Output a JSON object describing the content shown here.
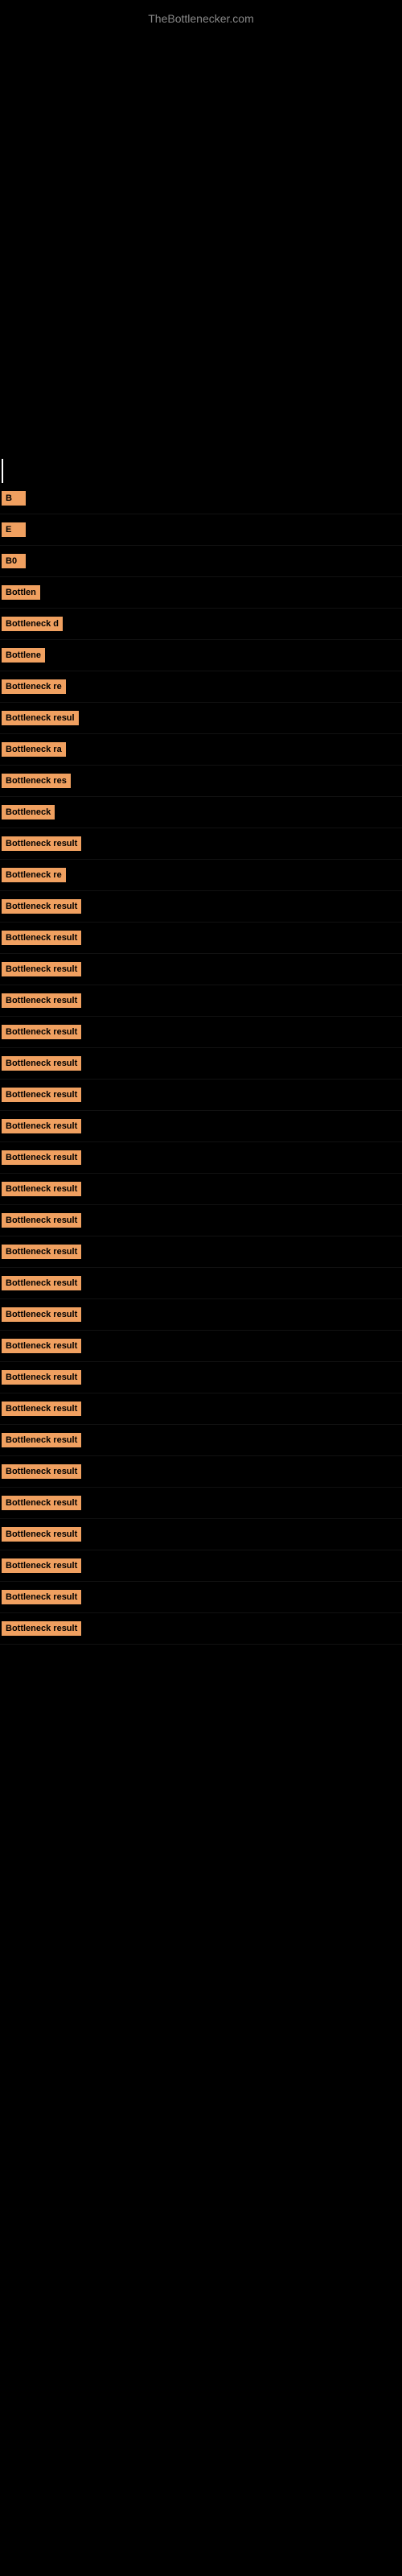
{
  "site": {
    "title": "TheBottlenecker.com"
  },
  "results": [
    {
      "id": 1,
      "label": "B",
      "tag_width": 30
    },
    {
      "id": 2,
      "label": "E",
      "tag_width": 30
    },
    {
      "id": 3,
      "label": "B0",
      "tag_width": 40
    },
    {
      "id": 4,
      "label": "Bottlen",
      "tag_width": 70
    },
    {
      "id": 5,
      "label": "Bottleneck d",
      "tag_width": 110
    },
    {
      "id": 6,
      "label": "Bottlene",
      "tag_width": 80
    },
    {
      "id": 7,
      "label": "Bottleneck re",
      "tag_width": 120
    },
    {
      "id": 8,
      "label": "Bottleneck resul",
      "tag_width": 145
    },
    {
      "id": 9,
      "label": "Bottleneck ra",
      "tag_width": 120
    },
    {
      "id": 10,
      "label": "Bottleneck res",
      "tag_width": 130
    },
    {
      "id": 11,
      "label": "Bottleneck",
      "tag_width": 100
    },
    {
      "id": 12,
      "label": "Bottleneck result",
      "tag_width": 150
    },
    {
      "id": 13,
      "label": "Bottleneck re",
      "tag_width": 120
    },
    {
      "id": 14,
      "label": "Bottleneck result",
      "tag_width": 160
    },
    {
      "id": 15,
      "label": "Bottleneck result",
      "tag_width": 160
    },
    {
      "id": 16,
      "label": "Bottleneck result",
      "tag_width": 165
    },
    {
      "id": 17,
      "label": "Bottleneck result",
      "tag_width": 165
    },
    {
      "id": 18,
      "label": "Bottleneck result",
      "tag_width": 170
    },
    {
      "id": 19,
      "label": "Bottleneck result",
      "tag_width": 170
    },
    {
      "id": 20,
      "label": "Bottleneck result",
      "tag_width": 170
    },
    {
      "id": 21,
      "label": "Bottleneck result",
      "tag_width": 170
    },
    {
      "id": 22,
      "label": "Bottleneck result",
      "tag_width": 175
    },
    {
      "id": 23,
      "label": "Bottleneck result",
      "tag_width": 175
    },
    {
      "id": 24,
      "label": "Bottleneck result",
      "tag_width": 180
    },
    {
      "id": 25,
      "label": "Bottleneck result",
      "tag_width": 180
    },
    {
      "id": 26,
      "label": "Bottleneck result",
      "tag_width": 185
    },
    {
      "id": 27,
      "label": "Bottleneck result",
      "tag_width": 185
    },
    {
      "id": 28,
      "label": "Bottleneck result",
      "tag_width": 190
    },
    {
      "id": 29,
      "label": "Bottleneck result",
      "tag_width": 195
    },
    {
      "id": 30,
      "label": "Bottleneck result",
      "tag_width": 198
    },
    {
      "id": 31,
      "label": "Bottleneck result",
      "tag_width": 200
    },
    {
      "id": 32,
      "label": "Bottleneck result",
      "tag_width": 200
    },
    {
      "id": 33,
      "label": "Bottleneck result",
      "tag_width": 202
    },
    {
      "id": 34,
      "label": "Bottleneck result",
      "tag_width": 205
    },
    {
      "id": 35,
      "label": "Bottleneck result",
      "tag_width": 207
    },
    {
      "id": 36,
      "label": "Bottleneck result",
      "tag_width": 209
    },
    {
      "id": 37,
      "label": "Bottleneck result",
      "tag_width": 210
    }
  ]
}
